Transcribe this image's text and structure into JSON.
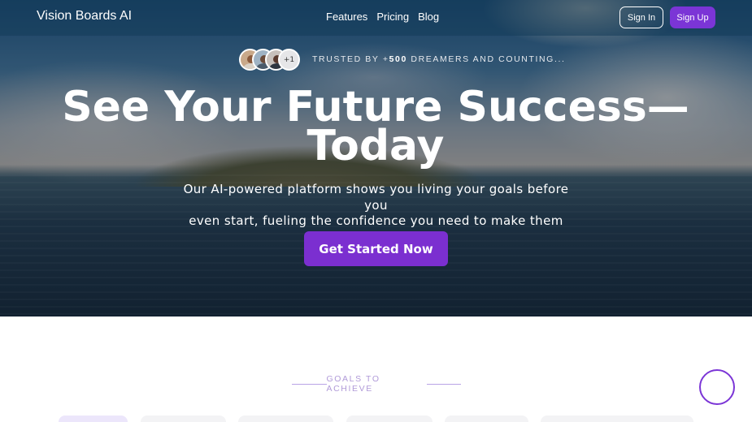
{
  "nav": {
    "brand": "Vision Boards AI",
    "links": [
      "Features",
      "Pricing",
      "Blog"
    ],
    "sign_in": "Sign In",
    "sign_up": "Sign Up"
  },
  "trust": {
    "avatar_more": "+1",
    "prefix": "TRUSTED BY +",
    "count": "500",
    "suffix": " DREAMERS AND COUNTING..."
  },
  "hero": {
    "headline_line1": "See Your Future Success—",
    "headline_line2": "Today",
    "subline_line1": "Our AI-powered platform shows you living your goals before you",
    "subline_line2": "even start, fueling the confidence you need to make them happen.",
    "cta": "Get Started Now"
  },
  "goals": {
    "label": "GOALS TO ACHIEVE"
  },
  "colors": {
    "accent": "#7b35d6",
    "cta": "#7b2fd0",
    "label": "#b09ad8"
  },
  "icons": {
    "chat": "chat-bubble-icon"
  }
}
